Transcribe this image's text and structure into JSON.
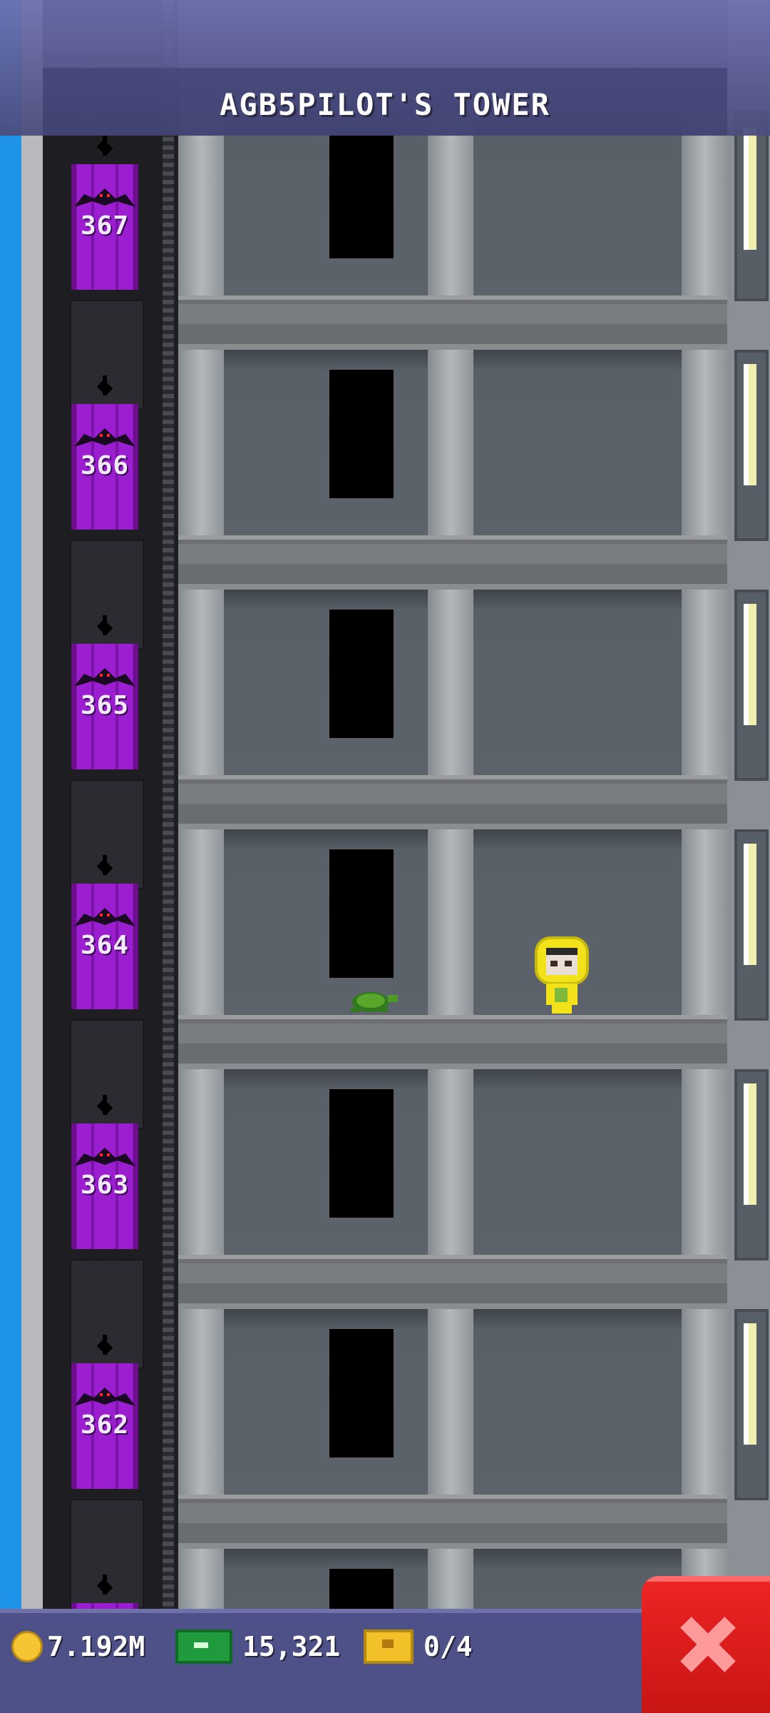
{
  "header": {
    "tower_name": "AGB5PILOT'S TOWER"
  },
  "elevator": {
    "floor_numbers": [
      "367",
      "366",
      "365",
      "364",
      "363",
      "362"
    ]
  },
  "status": {
    "coins": "7.192M",
    "bux": "15,321",
    "bitizens_quest": "0/4"
  },
  "colors": {
    "elevator_car": "#9b1ed0",
    "sky": "#1e93e8",
    "close_button": "#ec2424"
  },
  "icons": {
    "coin": "coin-icon",
    "bux": "bux-icon",
    "chest": "chest-icon",
    "close": "close-icon"
  }
}
